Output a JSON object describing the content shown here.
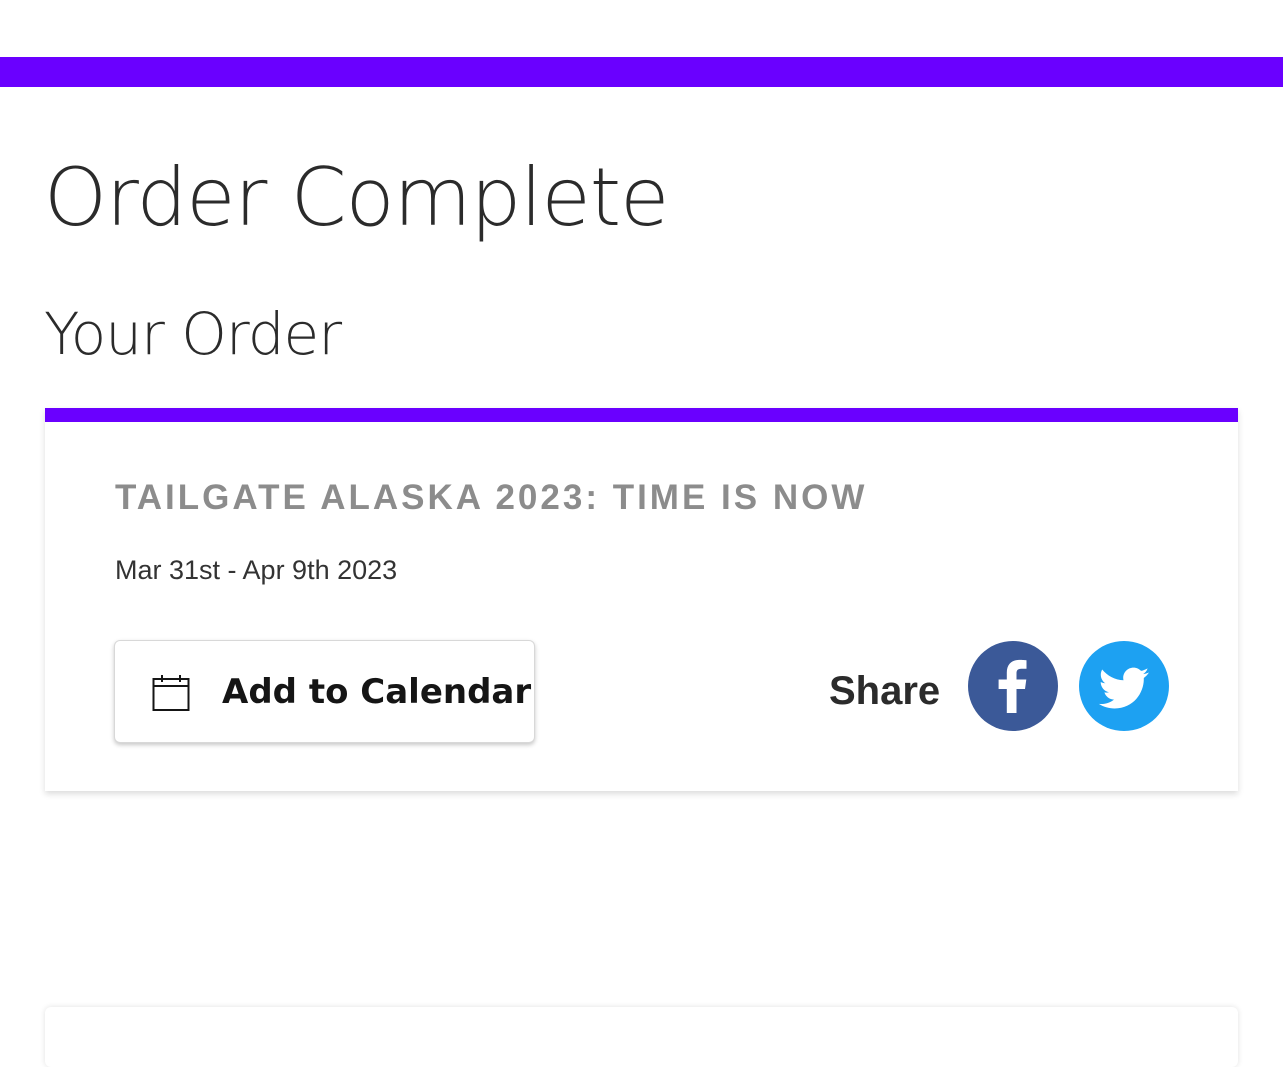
{
  "page": {
    "title": "Order Complete",
    "section_title": "Your Order",
    "accent_color": "#6a00ff"
  },
  "order": {
    "event_title": "TAILGATE ALASKA 2023: TIME IS NOW",
    "event_dates": "Mar 31st - Apr 9th 2023",
    "calendar_button": {
      "label": "Add to Calendar",
      "icon": "calendar-icon"
    },
    "share": {
      "label": "Share",
      "networks": [
        {
          "name": "facebook",
          "icon": "facebook-icon",
          "color": "#3b5998"
        },
        {
          "name": "twitter",
          "icon": "twitter-icon",
          "color": "#1da1f2"
        }
      ]
    }
  }
}
